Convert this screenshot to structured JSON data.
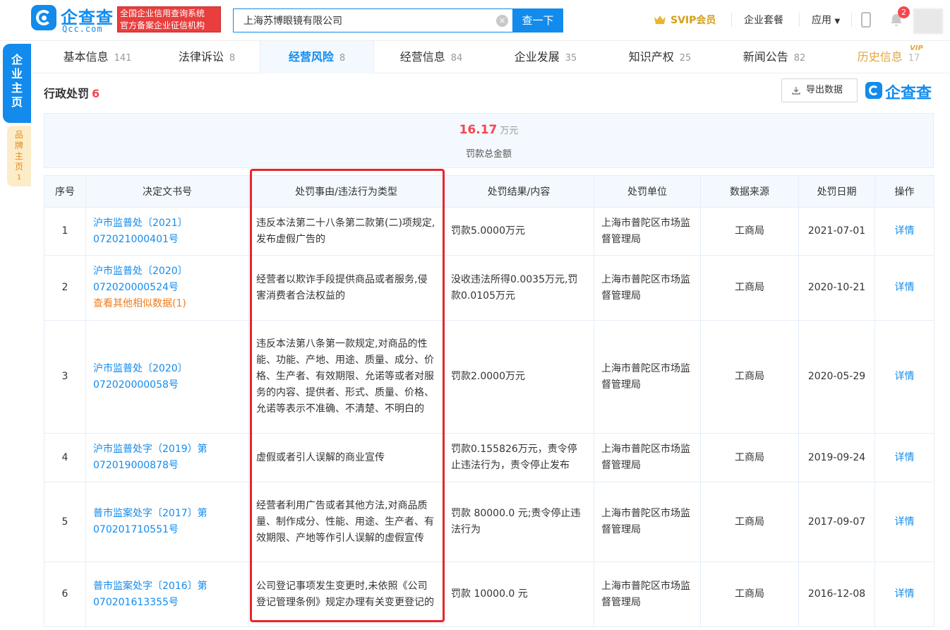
{
  "header": {
    "logo_text": "企查查",
    "logo_sub": "Qcc.com",
    "cert_line1": "全国企业信用查询系统",
    "cert_line2": "官方备案企业征信机构",
    "search_value": "上海苏博眼镜有限公司",
    "search_button": "查一下",
    "svip_label": "SVIP会员",
    "package_label": "企业套餐",
    "apps_label": "应用",
    "notification_count": "2"
  },
  "side": {
    "enterprise_home": "企业主页",
    "brand_home": "品牌主页",
    "brand_count": "1"
  },
  "tabs": [
    {
      "label": "基本信息",
      "count": "141"
    },
    {
      "label": "法律诉讼",
      "count": "8"
    },
    {
      "label": "经营风险",
      "count": "8"
    },
    {
      "label": "经营信息",
      "count": "84"
    },
    {
      "label": "企业发展",
      "count": "35"
    },
    {
      "label": "知识产权",
      "count": "25"
    },
    {
      "label": "新闻公告",
      "count": "82"
    },
    {
      "label": "历史信息",
      "count": "17"
    }
  ],
  "vip_tag": "VIP",
  "section": {
    "title": "行政处罚",
    "count": "6",
    "export_label": "导出数据",
    "brand_text": "企查查"
  },
  "summary": {
    "amount": "16.17",
    "unit": "万元",
    "label": "罚款总金额"
  },
  "table": {
    "headers": [
      "序号",
      "决定文书号",
      "处罚事由/违法行为类型",
      "处罚结果/内容",
      "处罚单位",
      "数据来源",
      "处罚日期",
      "操作"
    ],
    "rows": [
      {
        "no": "1",
        "doc": "沪市监普处〔2021〕072021000401号",
        "similar": "",
        "reason": "违反本法第二十八条第二款第(二)项规定,发布虚假广告的",
        "result": "罚款5.0000万元",
        "unit": "上海市普陀区市场监督管理局",
        "source": "工商局",
        "date": "2021-07-01",
        "action": "详情"
      },
      {
        "no": "2",
        "doc": "沪市监普处〔2020〕072020000524号",
        "similar": "查看其他相似数据(1)",
        "reason": "经营者以欺诈手段提供商品或者服务,侵害消费者合法权益的",
        "result": "没收违法所得0.0035万元,罚款0.0105万元",
        "unit": "上海市普陀区市场监督管理局",
        "source": "工商局",
        "date": "2020-10-21",
        "action": "详情"
      },
      {
        "no": "3",
        "doc": "沪市监普处〔2020〕072020000058号",
        "similar": "",
        "reason": "违反本法第八条第一款规定,对商品的性能、功能、产地、用途、质量、成分、价格、生产者、有效期限、允诺等或者对服务的内容、提供者、形式、质量、价格、允诺等表示不准确、不清楚、不明白的",
        "result": "罚款2.0000万元",
        "unit": "上海市普陀区市场监督管理局",
        "source": "工商局",
        "date": "2020-05-29",
        "action": "详情"
      },
      {
        "no": "4",
        "doc": "沪市监普处字（2019）第072019000878号",
        "similar": "",
        "reason": "虚假或者引人误解的商业宣传",
        "result": "罚款0.155826万元，责令停止违法行为，责令停止发布",
        "unit": "上海市普陀区市场监督管理局",
        "source": "工商局",
        "date": "2019-09-24",
        "action": "详情"
      },
      {
        "no": "5",
        "doc": "普市监案处字〔2017〕第070201710551号",
        "similar": "",
        "reason": "经营者利用广告或者其他方法,对商品质量、制作成分、性能、用途、生产者、有效期限、产地等作引人误解的虚假宣传",
        "result": "罚款 80000.0 元;责令停止违法行为",
        "unit": "上海市普陀区市场监督管理局",
        "source": "工商局",
        "date": "2017-09-07",
        "action": "详情"
      },
      {
        "no": "6",
        "doc": "普市监案处字〔2016〕第070201613355号",
        "similar": "",
        "reason": "公司登记事项发生变更时,未依照《公司登记管理条例》规定办理有关变更登记的",
        "result": "罚款 10000.0 元",
        "unit": "上海市普陀区市场监督管理局",
        "source": "工商局",
        "date": "2016-12-08",
        "action": "详情"
      }
    ]
  }
}
